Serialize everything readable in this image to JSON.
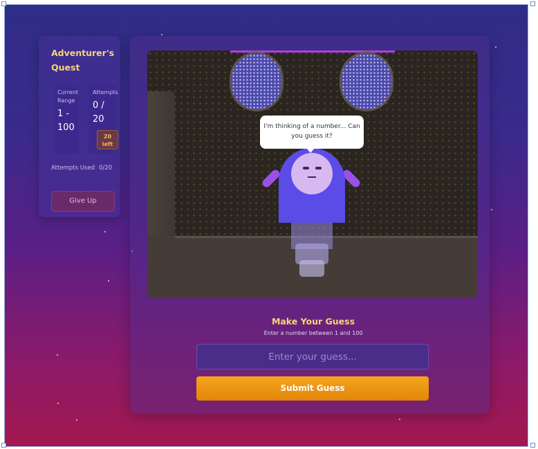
{
  "sidebar": {
    "title": "Adventurer's Quest",
    "range_label": "Current Range",
    "range_value": "1 - 100",
    "attempts_label": "Attempts",
    "attempts_value": "0 / 20",
    "attempts_left": "20 left",
    "used_label": "Attempts Used",
    "used_value": "0/20",
    "give_up_label": "Give Up"
  },
  "scene": {
    "speech": "I'm thinking of a number... Can you guess it?"
  },
  "guess": {
    "title": "Make Your Guess",
    "subtitle": "Enter a number between 1 and 100",
    "placeholder": "Enter your guess...",
    "submit_label": "Submit Guess"
  },
  "colors": {
    "accent": "#f7d37a",
    "button": "#f4a51c",
    "robot": "#5b4ce8"
  }
}
